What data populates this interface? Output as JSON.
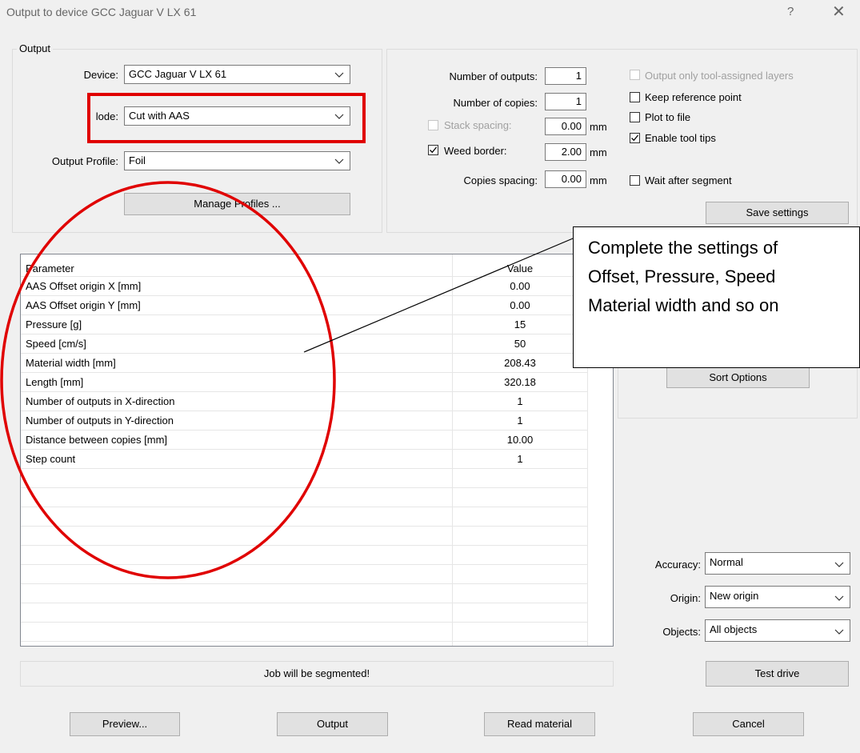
{
  "window": {
    "title": "Output to device GCC Jaguar V LX 61",
    "help_glyph": "?",
    "close_glyph": "✕"
  },
  "output_group": {
    "legend": "Output",
    "device_label": "Device:",
    "device_value": "GCC Jaguar V LX 61",
    "mode_label": "Mode:",
    "mode_label_visible": "lode:",
    "mode_value": "Cut with AAS",
    "profile_label": "Output Profile:",
    "profile_value": "Foil",
    "manage_profiles": "Manage Profiles ..."
  },
  "settings": {
    "num_outputs_label": "Number of outputs:",
    "num_outputs": "1",
    "num_copies_label": "Number of copies:",
    "num_copies": "1",
    "stack_spacing_label": "Stack spacing:",
    "stack_spacing": "0.00",
    "stack_spacing_checked": false,
    "weed_border_label": "Weed border:",
    "weed_border": "2.00",
    "weed_border_checked": true,
    "copies_spacing_label": "Copies spacing:",
    "copies_spacing": "0.00",
    "unit": "mm",
    "only_tool_layers": "Output only tool-assigned layers",
    "only_tool_layers_checked": false,
    "keep_ref": "Keep reference point",
    "keep_ref_checked": false,
    "plot_to_file": "Plot to file",
    "plot_to_file_checked": false,
    "enable_tips": "Enable tool tips",
    "enable_tips_checked": true,
    "wait_segment": "Wait after segment",
    "wait_segment_checked": false,
    "save_settings": "Save settings"
  },
  "grid": {
    "header": {
      "param": "Parameter",
      "value": "Value"
    },
    "rows": [
      {
        "param": "AAS Offset origin X [mm]",
        "value": "0.00"
      },
      {
        "param": "AAS Offset origin Y [mm]",
        "value": "0.00"
      },
      {
        "param": "Pressure [g]",
        "value": "15"
      },
      {
        "param": "Speed [cm/s]",
        "value": "50"
      },
      {
        "param": "Material width [mm]",
        "value": "208.43"
      },
      {
        "param": "Length [mm]",
        "value": "320.18"
      },
      {
        "param": "Number of outputs in X-direction",
        "value": "1"
      },
      {
        "param": "Number of outputs in Y-direction",
        "value": "1"
      },
      {
        "param": "Distance between copies [mm]",
        "value": "10.00"
      },
      {
        "param": "Step count",
        "value": "1"
      }
    ]
  },
  "sort_options": "Sort Options",
  "accuracy_label": "Accuracy:",
  "accuracy_value": "Normal",
  "origin_label": "Origin:",
  "origin_value": "New origin",
  "objects_label": "Objects:",
  "objects_value": "All objects",
  "status_text": "Job will be segmented!",
  "test_drive": "Test drive",
  "buttons": {
    "preview": "Preview...",
    "output": "Output",
    "read_material": "Read material",
    "cancel": "Cancel"
  },
  "callout": {
    "line1": "Complete the settings of",
    "line2": "Offset, Pressure, Speed",
    "line3": "Material width and so on"
  },
  "colors": {
    "highlight": "#e00000",
    "dialog_bg": "#f0f0f0"
  }
}
